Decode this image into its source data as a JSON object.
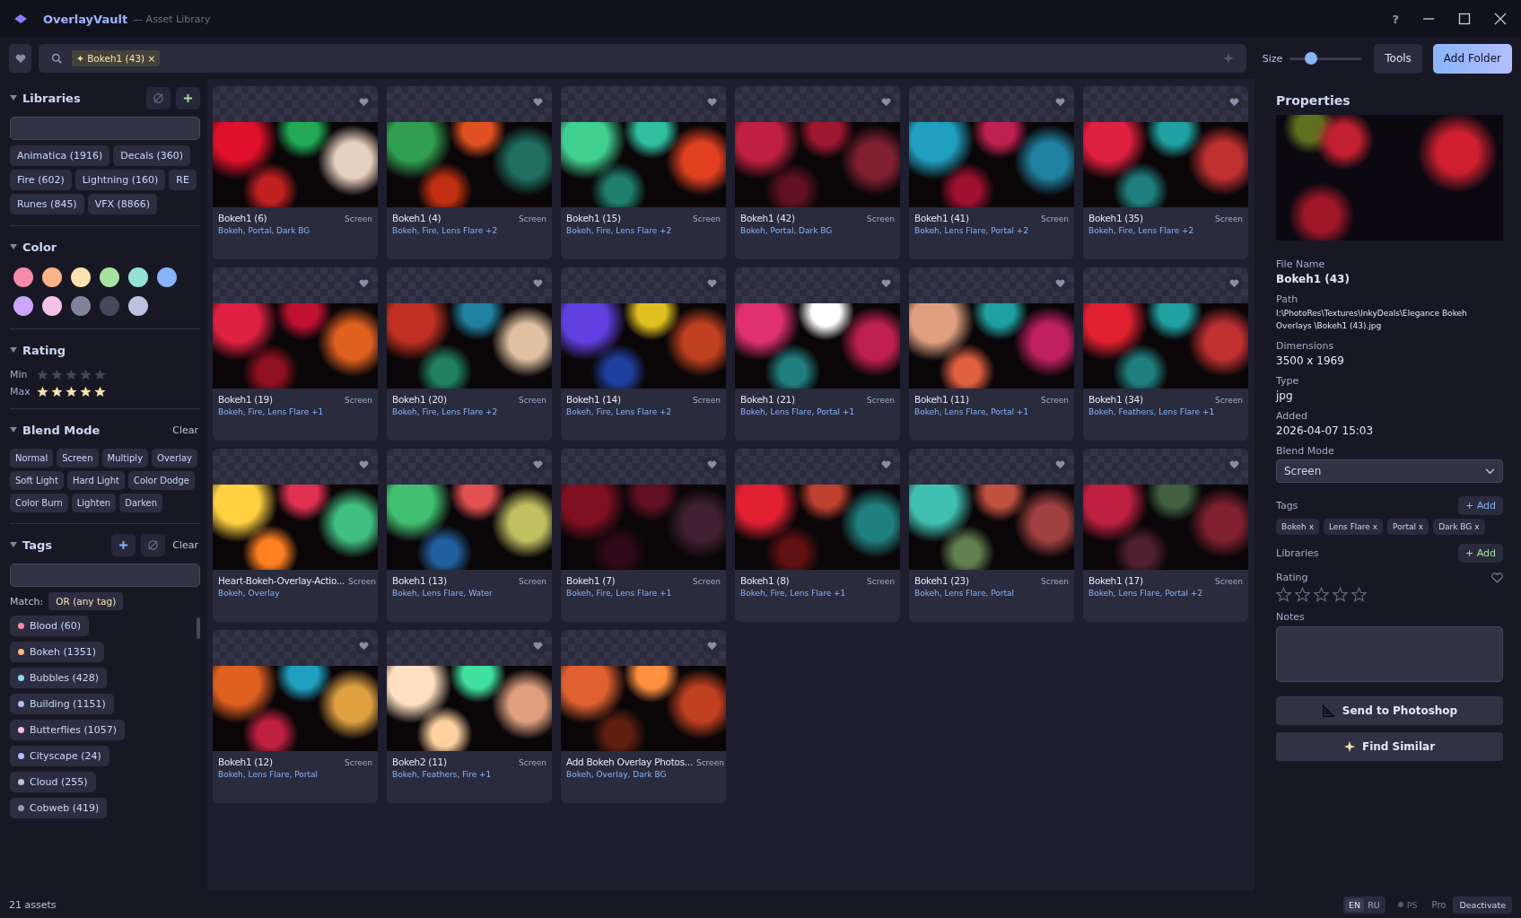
{
  "window": {
    "app_name": "OverlayVault",
    "subtitle": "— Asset Library",
    "controls": [
      "?"
    ]
  },
  "toolbar": {
    "search_chip": "✦ Bokeh1 (43) ×",
    "size_label": "Size",
    "size": {
      "level": 0.3
    },
    "buttons": [
      "Tools",
      "Add Folder"
    ]
  },
  "sidebar": {
    "libraries": {
      "title": "Libraries",
      "items": [
        "Animatica (1916)",
        "Decals (360)",
        "Fire (602)",
        "Lightning (160)",
        "RE",
        "Runes (845)",
        "VFX (8866)"
      ]
    },
    "color": {
      "title": "Color",
      "swatches": [
        {
          "color": "#f38ba8"
        },
        {
          "color": "#fab387"
        },
        {
          "color": "#f9e2af"
        },
        {
          "color": "#a6e3a1"
        },
        {
          "color": "#94e2d5"
        },
        {
          "color": "#89b4fa"
        },
        {
          "color": "#cba6f7"
        },
        {
          "color": "#f5c2e7"
        },
        {
          "color": "#7f849c"
        },
        {
          "color": "#45475a"
        },
        {
          "color": "#bac2de"
        }
      ]
    },
    "rating": {
      "title": "Rating",
      "min": {
        "label": "Min",
        "stars": 0
      },
      "max": {
        "label": "Max",
        "stars": 5
      }
    },
    "blend_mode": {
      "title": "Blend Mode",
      "clear": "Clear",
      "items": [
        {
          "label": "Normal",
          "selected": false
        },
        {
          "label": "Screen",
          "selected": false
        },
        {
          "label": "Multiply",
          "selected": false
        },
        {
          "label": "Overlay",
          "selected": false
        },
        {
          "label": "Soft Light",
          "selected": false
        },
        {
          "label": "Hard Light",
          "selected": false
        },
        {
          "label": "Color Dodge",
          "selected": false
        },
        {
          "label": "Color Burn",
          "selected": false
        },
        {
          "label": "Lighten",
          "selected": false
        },
        {
          "label": "Darken",
          "selected": false
        }
      ]
    },
    "tags": {
      "title": "Tags",
      "clear": "Clear",
      "match_label": "Match:",
      "match_value": "OR (any tag)",
      "items": [
        {
          "label": "Blood (60)",
          "color": "#f38ba8"
        },
        {
          "label": "Bokeh (1351)",
          "color": "#fab387"
        },
        {
          "label": "Bubbles (428)",
          "color": "#89dceb"
        },
        {
          "label": "Building (1151)",
          "color": "#b4befe"
        },
        {
          "label": "Butterflies (1057)",
          "color": "#f5c2e7"
        },
        {
          "label": "Cityscape (24)",
          "color": "#b4befe"
        },
        {
          "label": "Cloud (255)",
          "color": "#bac2de"
        },
        {
          "label": "Cobweb (419)",
          "color": "#9399b2"
        }
      ]
    }
  },
  "assets": [
    {
      "name": "Bokeh1 (6)",
      "blend": "Screen",
      "tags": "Bokeh, Portal, Dark BG"
    },
    {
      "name": "Bokeh1 (4)",
      "blend": "Screen",
      "tags": "Bokeh, Fire, Lens Flare +2"
    },
    {
      "name": "Bokeh1 (15)",
      "blend": "Screen",
      "tags": "Bokeh, Fire, Lens Flare +2"
    },
    {
      "name": "Bokeh1 (42)",
      "blend": "Screen",
      "tags": "Bokeh, Portal, Dark BG"
    },
    {
      "name": "Bokeh1 (41)",
      "blend": "Screen",
      "tags": "Bokeh, Lens Flare, Portal +2"
    },
    {
      "name": "Bokeh1 (35)",
      "blend": "Screen",
      "tags": "Bokeh, Fire, Lens Flare +2"
    },
    {
      "name": "Bokeh1 (19)",
      "blend": "Screen",
      "tags": "Bokeh, Fire, Lens Flare +1"
    },
    {
      "name": "Bokeh1 (20)",
      "blend": "Screen",
      "tags": "Bokeh, Fire, Lens Flare +2"
    },
    {
      "name": "Bokeh1 (14)",
      "blend": "Screen",
      "tags": "Bokeh, Fire, Lens Flare +2"
    },
    {
      "name": "Bokeh1 (21)",
      "blend": "Screen",
      "tags": "Bokeh, Lens Flare, Portal +1"
    },
    {
      "name": "Bokeh1 (11)",
      "blend": "Screen",
      "tags": "Bokeh, Lens Flare, Portal +1"
    },
    {
      "name": "Bokeh1 (34)",
      "blend": "Screen",
      "tags": "Bokeh, Feathers, Lens Flare +1"
    },
    {
      "name": "Heart-Bokeh-Overlay-Actio...",
      "blend": "Screen",
      "tags": "Bokeh, Overlay"
    },
    {
      "name": "Bokeh1 (13)",
      "blend": "Screen",
      "tags": "Bokeh, Lens Flare, Water"
    },
    {
      "name": "Bokeh1 (7)",
      "blend": "Screen",
      "tags": "Bokeh, Fire, Lens Flare +1"
    },
    {
      "name": "Bokeh1 (8)",
      "blend": "Screen",
      "tags": "Bokeh, Fire, Lens Flare +1"
    },
    {
      "name": "Bokeh1 (23)",
      "blend": "Screen",
      "tags": "Bokeh, Lens Flare, Portal"
    },
    {
      "name": "Bokeh1 (17)",
      "blend": "Screen",
      "tags": "Bokeh, Lens Flare, Portal +2"
    },
    {
      "name": "Bokeh1 (12)",
      "blend": "Screen",
      "tags": "Bokeh, Lens Flare, Portal"
    },
    {
      "name": "Bokeh2 (11)",
      "blend": "Screen",
      "tags": "Bokeh, Feathers, Fire +1"
    },
    {
      "name": "Add Bokeh Overlay Photos...",
      "blend": "Screen",
      "tags": "Bokeh, Overlay, Dark BG"
    }
  ],
  "properties": {
    "title": "Properties",
    "fields": [
      {
        "label": "File Name",
        "value": "Bokeh1 (43)",
        "kind": "bold"
      },
      {
        "label": "Path",
        "value": "I:\\PhotoRes\\Textures\\InkyDeals\\Elegance Bokeh Overlays \\Bokeh1 (43).jpg",
        "kind": "small"
      },
      {
        "label": "Dimensions",
        "value": "3500 x 1969",
        "kind": "plain"
      },
      {
        "label": "Type",
        "value": "jpg",
        "kind": "plain"
      },
      {
        "label": "Added",
        "value": "2026-04-07 15:03",
        "kind": "plain"
      }
    ],
    "blend_label": "Blend Mode",
    "blend_value": "Screen",
    "tags_label": "Tags",
    "tags_add": "+ Add",
    "tags": [
      "Bokeh x",
      "Lens Flare x",
      "Portal x",
      "Dark BG x"
    ],
    "libraries_label": "Libraries",
    "libraries_add": "+ Add",
    "rating_label": "Rating",
    "favorite": false,
    "rating": {
      "stars": 0
    },
    "notes_label": "Notes",
    "buttons": [
      {
        "label": "Send to Photoshop",
        "kind": "photoshop"
      },
      {
        "label": "Find Similar",
        "kind": "similar"
      }
    ]
  },
  "status_bar": {
    "count": "21 assets",
    "languages": [
      {
        "label": "EN",
        "selected": true
      },
      {
        "label": "RU",
        "selected": false
      }
    ],
    "ps": {
      "label": "PS",
      "on": false
    },
    "pro": "Pro",
    "deactivate": "Deactivate"
  }
}
